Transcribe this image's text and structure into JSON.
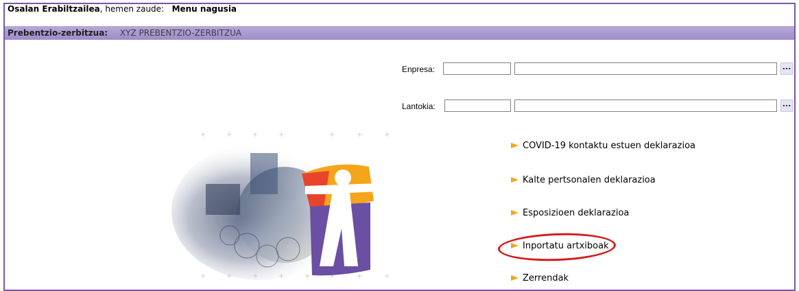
{
  "topbar": {
    "user_name": "Osalan Erabiltzailea",
    "location_text": ", hemen zaude:",
    "current_page": "Menu nagusia"
  },
  "service_bar": {
    "label": "Prebentzio-zerbitzua:",
    "value": "XYZ PREBENTZIO-ZERBITZUA"
  },
  "form": {
    "enpresa": {
      "label": "Enpresa:",
      "code_value": "",
      "name_value": "",
      "lookup_label": "..."
    },
    "lantokia": {
      "label": "Lantokia:",
      "code_value": "",
      "name_value": "",
      "lookup_label": "..."
    }
  },
  "menu": {
    "items": [
      {
        "label": "COVID-19 kontaktu estuen deklarazioa"
      },
      {
        "label": "Kalte pertsonalen deklarazioa"
      },
      {
        "label": "Esposizioen deklarazioa"
      },
      {
        "label": "Inportatu artxiboak",
        "highlighted": true
      },
      {
        "label": "Zerrendak"
      }
    ]
  },
  "colors": {
    "frame_border": "#7b54a8",
    "service_bar": "#b6a9d8",
    "arrow": "#f5a51a",
    "highlight_ring": "#d41c1c",
    "logo_purple": "#6a4fa2",
    "logo_orange": "#f5a51a",
    "logo_red": "#e8432b"
  },
  "icons": {
    "menu_arrow": "arrow-right-icon",
    "lookup": "ellipsis-icon",
    "logo": "osalan-figure-logo"
  }
}
